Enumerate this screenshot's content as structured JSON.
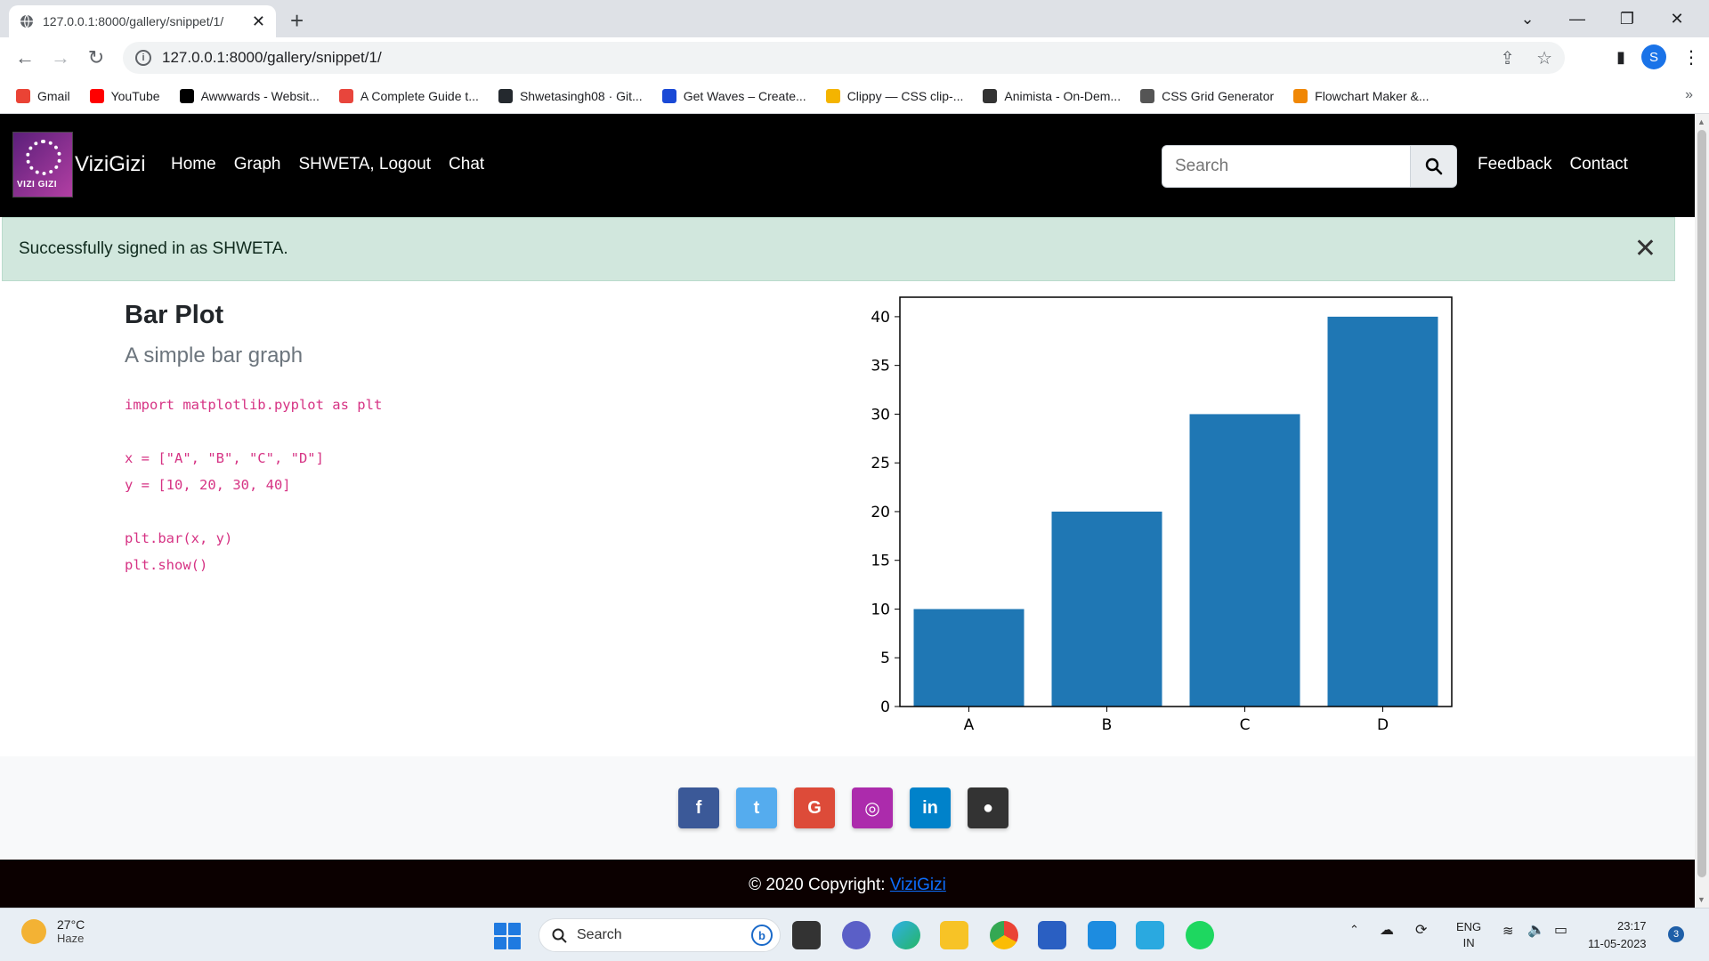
{
  "browser": {
    "tab_title": "127.0.0.1:8000/gallery/snippet/1/",
    "url": "127.0.0.1:8000/gallery/snippet/1/",
    "profile_initial": "S",
    "bookmarks": [
      {
        "label": "Gmail",
        "color": "#ea4335"
      },
      {
        "label": "YouTube",
        "color": "#ff0000"
      },
      {
        "label": "Awwwards - Websit...",
        "color": "#000000"
      },
      {
        "label": "A Complete Guide t...",
        "color": "#e8453c"
      },
      {
        "label": "Shwetasingh08 · Git...",
        "color": "#24292e"
      },
      {
        "label": "Get Waves – Create...",
        "color": "#1a49d6"
      },
      {
        "label": "Clippy — CSS clip-...",
        "color": "#f4b400"
      },
      {
        "label": "Animista - On-Dem...",
        "color": "#333333"
      },
      {
        "label": "CSS Grid Generator",
        "color": "#555555"
      },
      {
        "label": "Flowchart Maker &...",
        "color": "#f08705"
      }
    ]
  },
  "site": {
    "brand": "ViziGizi",
    "logo_text": "VIZI GIZI",
    "nav_links": [
      "Home",
      "Graph",
      "SHWETA, Logout",
      "Chat"
    ],
    "search_placeholder": "Search",
    "right_links": [
      "Feedback",
      "Contact"
    ],
    "alert": "Successfully signed in as SHWETA.",
    "title": "Bar Plot",
    "subtitle": "A simple bar graph",
    "code_lines": [
      "import matplotlib.pyplot as plt",
      "",
      "x = [\"A\", \"B\", \"C\", \"D\"]",
      "y = [10, 20, 30, 40]",
      "",
      "plt.bar(x, y)",
      "plt.show()"
    ],
    "social": [
      {
        "name": "facebook",
        "glyph": "f",
        "color": "#3b5998"
      },
      {
        "name": "twitter",
        "glyph": "t",
        "color": "#55acee"
      },
      {
        "name": "google",
        "glyph": "G",
        "color": "#dd4b39"
      },
      {
        "name": "instagram",
        "glyph": "◎",
        "color": "#ac2bac"
      },
      {
        "name": "linkedin",
        "glyph": "in",
        "color": "#0082ca"
      },
      {
        "name": "github",
        "glyph": "●",
        "color": "#333333"
      }
    ],
    "copyright_prefix": "© 2020 Copyright: ",
    "copyright_link": "ViziGizi"
  },
  "chart_data": {
    "type": "bar",
    "categories": [
      "A",
      "B",
      "C",
      "D"
    ],
    "values": [
      10,
      20,
      30,
      40
    ],
    "yticks": [
      0,
      5,
      10,
      15,
      20,
      25,
      30,
      35,
      40
    ],
    "ylim": [
      0,
      42
    ],
    "bar_color": "#1f77b4",
    "title": "",
    "xlabel": "",
    "ylabel": ""
  },
  "taskbar": {
    "temp": "27°C",
    "condition": "Haze",
    "search_label": "Search",
    "lang_1": "ENG",
    "lang_2": "IN",
    "time": "23:17",
    "date": "11-05-2023",
    "notifications": "3"
  }
}
